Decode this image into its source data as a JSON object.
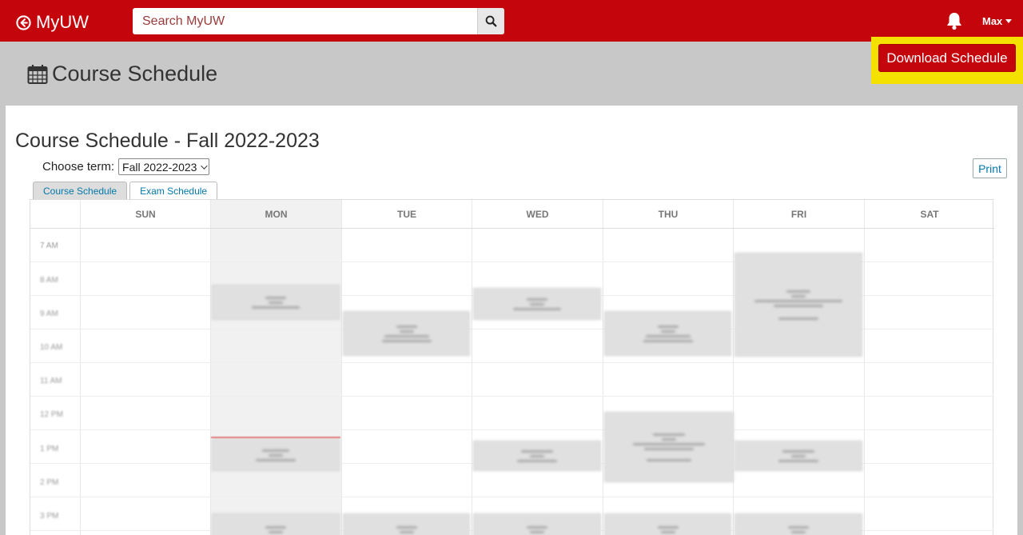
{
  "topbar": {
    "brand": "MyUW",
    "search_placeholder": "Search MyUW",
    "user": "Max"
  },
  "header": {
    "title": "Course Schedule",
    "download_label": "Download Schedule"
  },
  "schedule": {
    "title": "Course Schedule - Fall 2022-2023",
    "term_label": "Choose term:",
    "term_value": "Fall 2022-2023",
    "print_label": "Print",
    "tabs": [
      {
        "label": "Course Schedule",
        "active": true
      },
      {
        "label": "Exam Schedule",
        "active": false
      }
    ],
    "days": [
      "SUN",
      "MON",
      "TUE",
      "WED",
      "THU",
      "FRI",
      "SAT"
    ],
    "times": [
      "7 AM",
      "8 AM",
      "9 AM",
      "10 AM",
      "11 AM",
      "12 PM",
      "1 PM",
      "2 PM",
      "3 PM"
    ]
  },
  "colors": {
    "brand_red": "#c5050c",
    "highlight": "#f5e100",
    "link_blue": "#0479a8"
  },
  "icons": [
    "back-arrow-icon",
    "search-icon",
    "bell-icon",
    "calendar-icon",
    "caret-down-icon"
  ]
}
